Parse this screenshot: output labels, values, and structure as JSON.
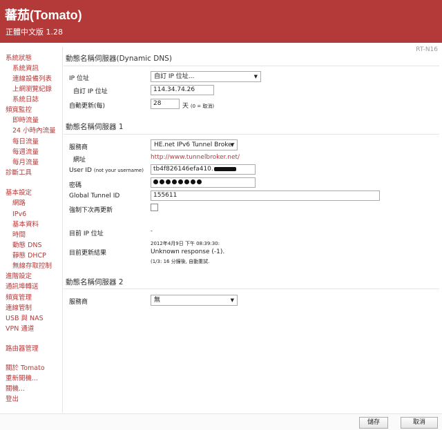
{
  "header": {
    "title": "蕃茄(Tomato)",
    "version": "正體中文版 1.28"
  },
  "model": "RT-N16",
  "sidebar": {
    "items": [
      "系統狀態",
      "系統資訊",
      "連線設備列表",
      "上網瀏覽紀錄",
      "系統日誌",
      "頻寬監控",
      "即時流量",
      "24 小時內流量",
      "每日流量",
      "每週流量",
      "每月流量",
      "診斷工具",
      "基本設定",
      "網路",
      "IPv6",
      "基本資料",
      "時間",
      "動態 DNS",
      "靜態 DHCP",
      "無線存取控制",
      "進階設定",
      "通訊埠轉送",
      "頻寬管理",
      "連線管制",
      "USB 與 NAS",
      "VPN 通道",
      "路由器管理",
      "關於 Tomato",
      "重新開機...",
      "關機...",
      "登出"
    ]
  },
  "ddns": {
    "title": "動態名稱伺服器(Dynamic DNS)",
    "ip_label": "IP 位址",
    "ip_select": "自訂 IP 位址...",
    "custom_ip_label": "自訂 IP 位址",
    "custom_ip_value": "114.34.74.26",
    "auto_update_label": "自動更新(每)",
    "auto_update_value": "28",
    "auto_update_unit": "天",
    "auto_update_hint": "(0 = 取消)"
  },
  "server1": {
    "title": "動態名稱伺服器 1",
    "provider_label": "服務商",
    "provider_value": "HE.net IPv6 Tunnel Broker",
    "url_label": "網址",
    "url_value": "http://www.tunnelbroker.net/",
    "userid_label": "User ID",
    "userid_hint": "(not your username)",
    "userid_value": "tb4f826146efa410.",
    "password_label": "密碼",
    "tunnel_label": "Global Tunnel ID",
    "tunnel_value": "155611",
    "force_label": "強制下次再更新",
    "current_ip_label": "目前 IP 位址",
    "current_ip_value": "-",
    "last_result_label": "目前更新結果",
    "last_result_time": "2012年4月9日 下午 08:39:30:",
    "last_result_msg": "Unknown response (-1).",
    "last_result_note": "(1/3: 16 分鐘後, 自動重試."
  },
  "server2": {
    "title": "動態名稱伺服器 2",
    "provider_label": "服務商",
    "provider_value": "無"
  },
  "footer": {
    "save": "儲存",
    "cancel": "取消"
  }
}
